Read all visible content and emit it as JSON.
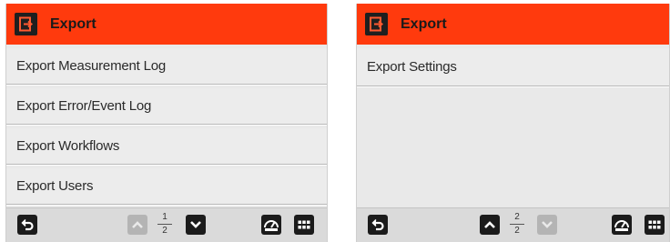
{
  "screens": [
    {
      "header": {
        "title": "Export",
        "icon": "export-icon"
      },
      "menu": [
        "Export Measurement Log",
        "Export Error/Event Log",
        "Export Workflows",
        "Export Users"
      ],
      "page": {
        "current": "1",
        "total": "2"
      },
      "nav": {
        "up_enabled": false,
        "down_enabled": true
      }
    },
    {
      "header": {
        "title": "Export",
        "icon": "export-icon"
      },
      "menu": [
        "Export Settings"
      ],
      "page": {
        "current": "2",
        "total": "2"
      },
      "nav": {
        "up_enabled": true,
        "down_enabled": false
      }
    }
  ],
  "colors": {
    "header": "#ff3a0d",
    "button_dark": "#1b1b1b",
    "button_disabled": "#b4b4b4"
  }
}
